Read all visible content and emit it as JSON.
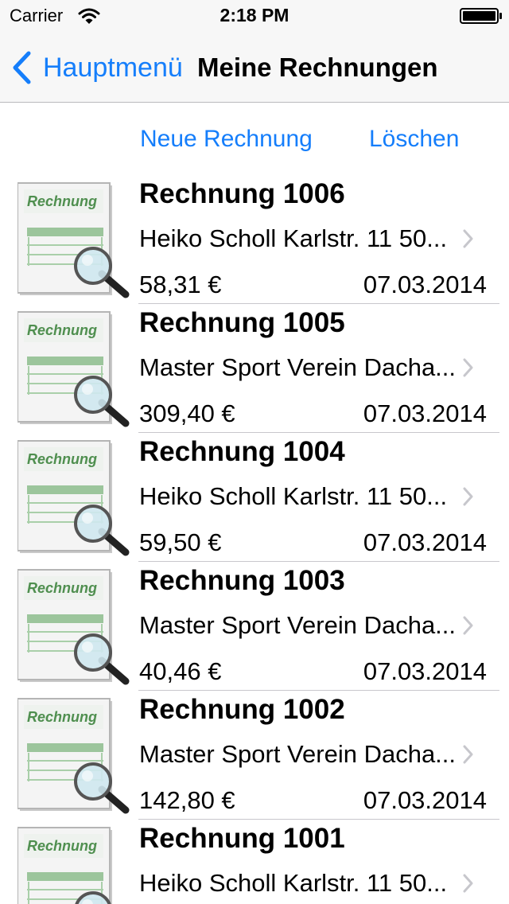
{
  "status": {
    "carrier": "Carrier",
    "time": "2:18 PM"
  },
  "nav": {
    "back_label": "Hauptmenü",
    "title": "Meine Rechnungen"
  },
  "toolbar": {
    "new_label": "Neue Rechnung",
    "delete_label": "Löschen"
  },
  "thumbnail_text": "Rechnung",
  "invoices": [
    {
      "title": "Rechnung 1006",
      "customer": "Heiko Scholl Karlstr. 11 50...",
      "amount": "58,31 €",
      "date": "07.03.2014"
    },
    {
      "title": "Rechnung 1005",
      "customer": "Master Sport Verein Dacha...",
      "amount": "309,40 €",
      "date": "07.03.2014"
    },
    {
      "title": "Rechnung 1004",
      "customer": "Heiko Scholl Karlstr. 11 50...",
      "amount": "59,50 €",
      "date": "07.03.2014"
    },
    {
      "title": "Rechnung 1003",
      "customer": "Master Sport Verein Dacha...",
      "amount": "40,46 €",
      "date": "07.03.2014"
    },
    {
      "title": "Rechnung 1002",
      "customer": "Master Sport Verein Dacha...",
      "amount": "142,80 €",
      "date": "07.03.2014"
    },
    {
      "title": "Rechnung 1001",
      "customer": "Heiko Scholl Karlstr. 11 50...",
      "amount": "",
      "date": ""
    }
  ],
  "colors": {
    "accent": "#157efb",
    "thumb_green": "#8ab88a",
    "separator": "#c8c7cc"
  }
}
